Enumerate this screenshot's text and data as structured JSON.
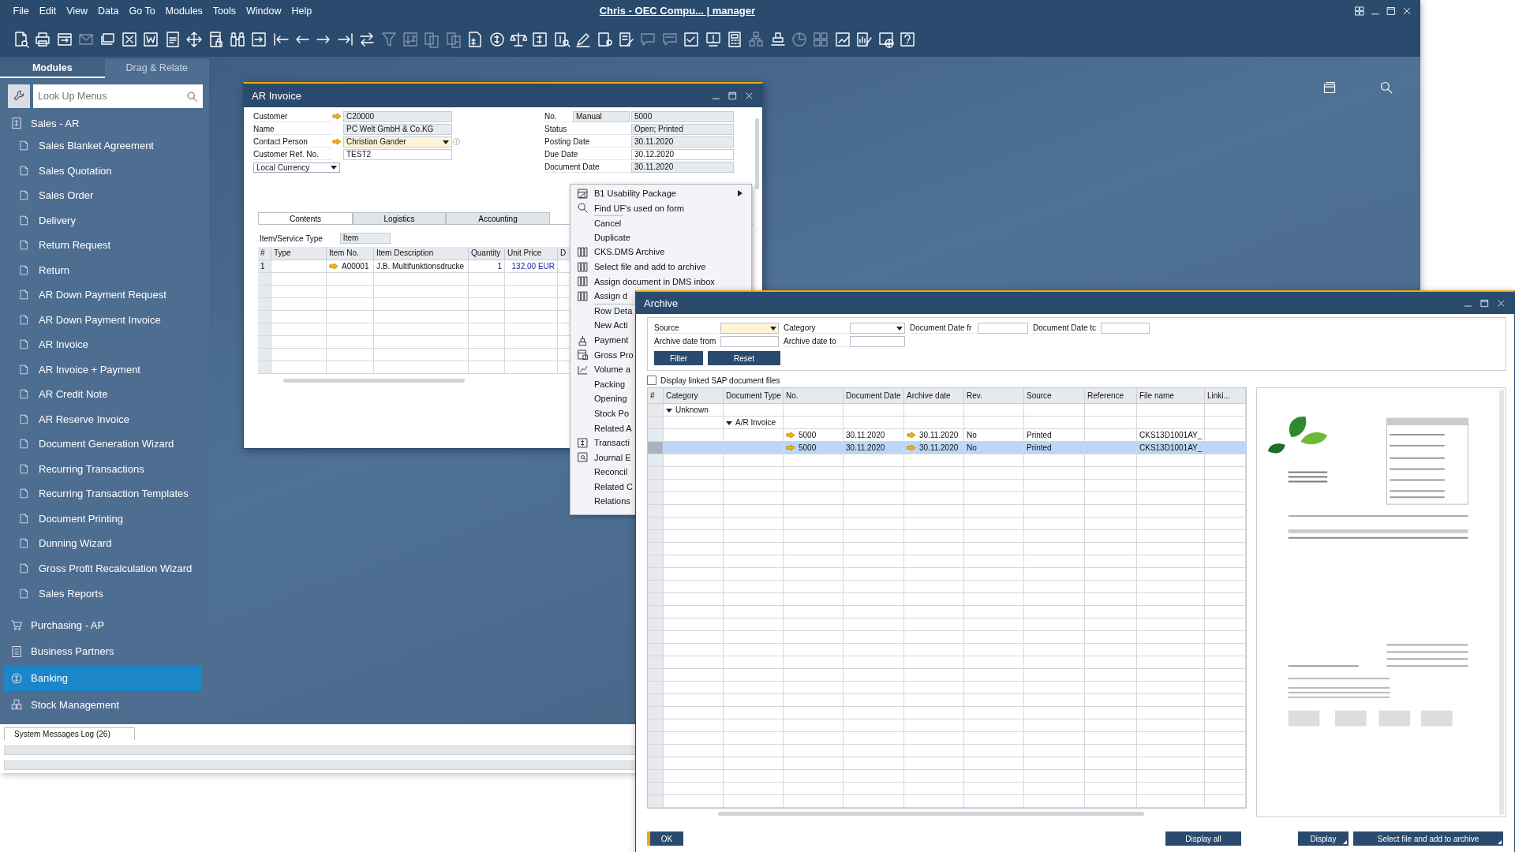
{
  "menu_bar": {
    "items": [
      "File",
      "Edit",
      "View",
      "Data",
      "Go To",
      "Modules",
      "Tools",
      "Window",
      "Help"
    ],
    "title": "Chris - OEC Compu... | manager"
  },
  "toolbar": [
    {
      "disabled": false
    },
    {
      "disabled": false
    },
    {
      "disabled": false
    },
    {
      "disabled": true
    },
    {
      "disabled": false
    },
    {
      "disabled": false
    },
    {
      "disabled": false
    },
    {
      "disabled": false
    },
    {
      "disabled": false
    },
    {
      "disabled": false
    },
    {
      "disabled": false
    },
    {
      "disabled": false
    },
    {
      "disabled": false
    },
    {
      "disabled": false
    },
    {
      "disabled": false
    },
    {
      "disabled": false
    },
    {
      "disabled": false
    },
    {
      "disabled": true
    },
    {
      "disabled": true
    },
    {
      "disabled": true
    },
    {
      "disabled": true
    },
    {
      "disabled": false
    },
    {
      "disabled": false
    },
    {
      "disabled": false
    },
    {
      "disabled": false
    },
    {
      "disabled": false
    },
    {
      "disabled": false
    },
    {
      "disabled": false
    },
    {
      "disabled": false
    },
    {
      "disabled": true
    },
    {
      "disabled": true
    },
    {
      "disabled": false
    },
    {
      "disabled": false
    },
    {
      "disabled": false
    },
    {
      "disabled": true
    },
    {
      "disabled": false
    },
    {
      "disabled": true
    },
    {
      "disabled": true
    },
    {
      "disabled": false
    },
    {
      "disabled": false
    },
    {
      "disabled": false
    },
    {
      "disabled": false
    }
  ],
  "sidebar": {
    "tabs": [
      {
        "label": "Modules",
        "selected": true
      },
      {
        "label": "Drag & Relate",
        "selected": false
      }
    ],
    "search": {
      "placeholder": "Look Up Menus"
    },
    "modules": [
      {
        "label": "Sales - AR",
        "selected": false,
        "children": [
          {
            "label": "Sales Blanket Agreement",
            "selected": false
          },
          {
            "label": "Sales Quotation",
            "selected": false
          },
          {
            "label": "Sales Order",
            "selected": false
          },
          {
            "label": "Delivery",
            "selected": false
          },
          {
            "label": "Return Request",
            "selected": false
          },
          {
            "label": "Return",
            "selected": false
          },
          {
            "label": "AR Down Payment Request",
            "selected": false
          },
          {
            "label": "AR Down Payment Invoice",
            "selected": false
          },
          {
            "label": "AR Invoice",
            "selected": false
          },
          {
            "label": "AR Invoice + Payment",
            "selected": false
          },
          {
            "label": "AR Credit Note",
            "selected": false
          },
          {
            "label": "AR Reserve Invoice",
            "selected": false
          },
          {
            "label": "Document Generation Wizard",
            "selected": false
          },
          {
            "label": "Recurring Transactions",
            "selected": false
          },
          {
            "label": "Recurring Transaction Templates",
            "selected": false
          },
          {
            "label": "Document Printing",
            "selected": false
          },
          {
            "label": "Dunning Wizard",
            "selected": false
          },
          {
            "label": "Gross Profit Recalculation Wizard",
            "selected": false
          },
          {
            "label": "Sales Reports",
            "selected": false
          }
        ]
      },
      {
        "label": "Purchasing - AP",
        "selected": false
      },
      {
        "label": "Business Partners",
        "selected": false
      },
      {
        "label": "Banking",
        "selected": true
      },
      {
        "label": "Stock Management",
        "selected": false
      }
    ]
  },
  "ar_invoice": {
    "title": "AR Invoice",
    "left_fields": [
      {
        "label": "Customer",
        "value": "C20000",
        "link": true,
        "editable": false,
        "focused": false
      },
      {
        "label": "Name",
        "value": "PC Welt GmbH & Co.KG",
        "link": false,
        "editable": false,
        "focused": false
      },
      {
        "label": "Contact Person",
        "value": "Christian Gander",
        "link": true,
        "editable": true,
        "focused": true
      },
      {
        "label": "Customer Ref. No.",
        "value": "TEST2",
        "link": false,
        "editable": true,
        "focused": false
      }
    ],
    "currency": "Local Currency",
    "right_fields": [
      {
        "label": "No.",
        "series": "Manual",
        "value": "5000",
        "editable": false
      },
      {
        "label": "Status",
        "value": "Open; Printed",
        "editable": false
      },
      {
        "label": "Posting Date",
        "value": "30.11.2020",
        "editable": false
      },
      {
        "label": "Due Date",
        "value": "30.12.2020",
        "editable": true
      },
      {
        "label": "Document Date",
        "value": "30.11.2020",
        "editable": false
      }
    ],
    "tabs": [
      {
        "label": "Contents",
        "selected": true
      },
      {
        "label": "Logistics",
        "selected": false
      },
      {
        "label": "Accounting",
        "selected": false
      }
    ],
    "item_type": {
      "label": "Item/Service Type",
      "value": "Item"
    },
    "table": {
      "columns": [
        "#",
        "Type",
        "Item No.",
        "Item Description",
        "Quantity",
        "Unit Price",
        "D"
      ],
      "rows": [
        {
          "number": "1",
          "item_no": "A00001",
          "description": "J.B. Multifunktionsdrucke",
          "quantity": "1",
          "unit_price": "132,00 EUR"
        }
      ]
    }
  },
  "context_menu": {
    "items": [
      {
        "label": "B1 Usability Package",
        "submenu": true,
        "separator_before": false
      },
      {
        "label": "Find UF's used on form",
        "submenu": false,
        "separator_before": false
      },
      {
        "label": "Cancel",
        "submenu": false,
        "separator_before": true
      },
      {
        "label": "Duplicate",
        "submenu": false,
        "separator_before": false
      },
      {
        "label": "CKS.DMS Archive",
        "submenu": false,
        "separator_before": false
      },
      {
        "label": "Select file and add to archive",
        "submenu": false,
        "separator_before": false
      },
      {
        "label": "Assign document in DMS inbox",
        "submenu": false,
        "separator_before": false
      },
      {
        "label": "Assign d",
        "submenu": false,
        "separator_before": false
      },
      {
        "label": "Row Deta",
        "submenu": false,
        "separator_before": true
      },
      {
        "label": "New Acti",
        "submenu": false,
        "separator_before": false
      },
      {
        "label": "Payment",
        "submenu": false,
        "separator_before": false
      },
      {
        "label": "Gross Pro",
        "submenu": false,
        "separator_before": false
      },
      {
        "label": "Volume a",
        "submenu": false,
        "separator_before": false
      },
      {
        "label": "Packing",
        "submenu": false,
        "separator_before": false
      },
      {
        "label": "Opening",
        "submenu": false,
        "separator_before": false
      },
      {
        "label": "Stock Po",
        "submenu": false,
        "separator_before": false
      },
      {
        "label": "Related A",
        "submenu": false,
        "separator_before": false
      },
      {
        "label": "Transacti",
        "submenu": false,
        "separator_before": false
      },
      {
        "label": "Journal E",
        "submenu": false,
        "separator_before": false
      },
      {
        "label": "Reconcil",
        "submenu": false,
        "separator_before": false
      },
      {
        "label": "Related C",
        "submenu": false,
        "separator_before": false
      },
      {
        "label": "Relations",
        "submenu": false,
        "separator_before": false
      }
    ]
  },
  "archive": {
    "title": "Archive",
    "filters": [
      {
        "label": "Source",
        "kind": "dropdown",
        "focused": true
      },
      {
        "label": "Category",
        "kind": "dropdown",
        "focused": false
      },
      {
        "label": "Document Date fr",
        "kind": "text",
        "focused": false
      },
      {
        "label": "Document Date tc",
        "kind": "text",
        "focused": false
      },
      {
        "label": "Archive date from",
        "kind": "text",
        "focused": false
      },
      {
        "label": "Archive date to",
        "kind": "text",
        "focused": false
      }
    ],
    "filter_buttons": [
      "Filter",
      "Reset"
    ],
    "checkbox": {
      "label": "Display linked SAP document files",
      "checked": false
    },
    "table": {
      "columns": [
        "#",
        "Category",
        "Document Type",
        "No.",
        "Document Date",
        "Archive date",
        "Rev.",
        "Source",
        "Reference",
        "File name",
        "Linki..."
      ],
      "tree": [
        {
          "label": "Unknown",
          "expanded": true,
          "selected": false,
          "children": [
            {
              "label": "A/R Invoice",
              "expanded": true,
              "selected": false,
              "children": [
                {
                  "no": "5000",
                  "document_date": "30.11.2020",
                  "archive_date": "30.11.2020",
                  "rev": "No",
                  "source": "Printed",
                  "file_name": "CKS13D1001AY_",
                  "selected": false
                },
                {
                  "no": "5000",
                  "document_date": "30.11.2020",
                  "archive_date": "30.11.2020",
                  "rev": "No",
                  "source": "Printed",
                  "file_name": "CKS13D1001AY_",
                  "selected": true
                }
              ]
            }
          ]
        }
      ]
    },
    "footer_buttons": [
      {
        "label": "OK",
        "kind": "primary"
      },
      {
        "label": "Display all",
        "kind": "plain"
      },
      {
        "label": "Display",
        "kind": "menu"
      },
      {
        "label": "Select file and add to archive",
        "kind": "menu"
      }
    ]
  },
  "status_bar": {
    "tab": "System Messages Log (26)"
  }
}
